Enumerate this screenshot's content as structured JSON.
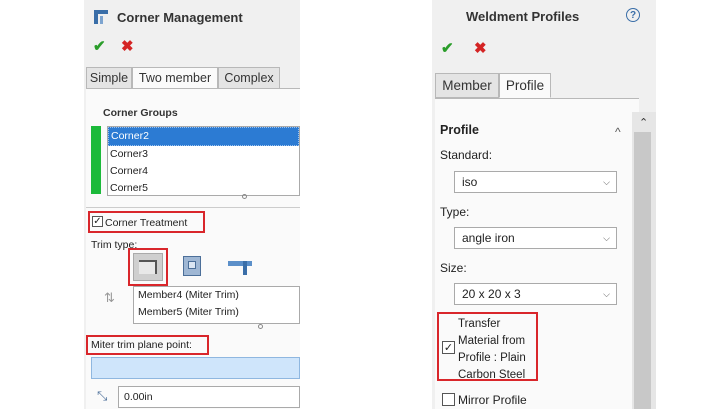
{
  "left_panel": {
    "title": "Corner Management",
    "tabs": [
      "Simple",
      "Two member",
      "Complex"
    ],
    "corner_groups": {
      "label": "Corner Groups",
      "items": [
        "Corner2",
        "Corner3",
        "Corner4",
        "Corner5"
      ]
    },
    "corner_treatment_label": "Corner Treatment",
    "trim_type_label": "Trim type:",
    "members": [
      "Member4 (Miter Trim)",
      "Member5 (Miter Trim)"
    ],
    "miter_label": "Miter trim plane point:",
    "offset_value": "0.00in",
    "colors": {
      "group_bar": "#1cba3a",
      "selection": "#2c7bd3",
      "highlight_box": "#d9262b"
    }
  },
  "right_panel": {
    "title": "Weldment Profiles",
    "tabs": [
      "Member",
      "Profile"
    ],
    "section_title": "Profile",
    "standard_label": "Standard:",
    "standard_value": "iso",
    "type_label": "Type:",
    "type_value": "angle iron",
    "size_label": "Size:",
    "size_value": "20 x 20 x 3",
    "transfer_lines": [
      "Transfer",
      "Material from",
      "Profile : Plain",
      "Carbon Steel"
    ],
    "mirror_label": "Mirror Profile",
    "icons": {
      "confirm": "✔",
      "cancel": "✖",
      "help": "?",
      "collapse": "^"
    }
  }
}
